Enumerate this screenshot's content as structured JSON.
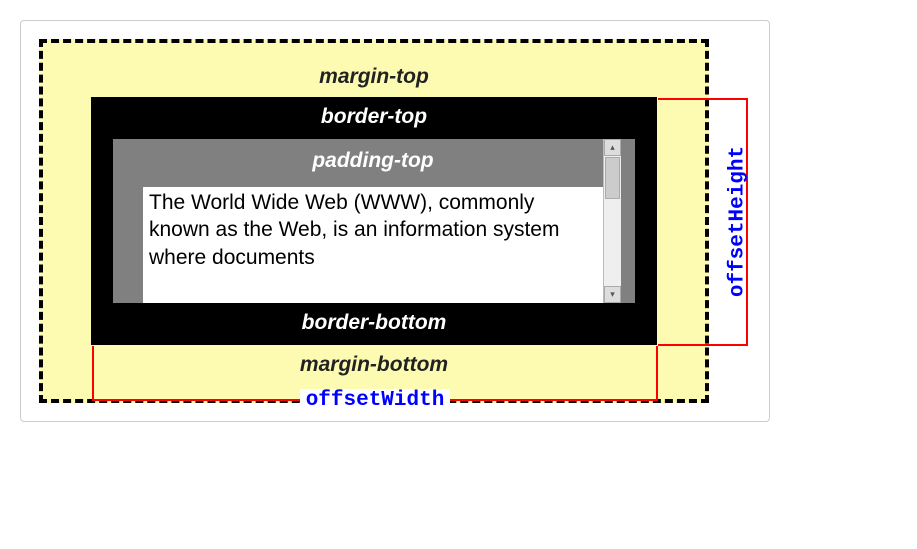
{
  "labels": {
    "margin_top": "margin-top",
    "margin_bottom": "margin-bottom",
    "border_top": "border-top",
    "border_bottom": "border-bottom",
    "padding_top": "padding-top"
  },
  "content": {
    "text": "The World Wide Web (WWW), commonly known as the Web, is an information system where documents"
  },
  "measurements": {
    "offset_width": "offsetWidth",
    "offset_height": "offsetHeight"
  },
  "scrollbar": {
    "up": "▴",
    "down": "▾"
  }
}
